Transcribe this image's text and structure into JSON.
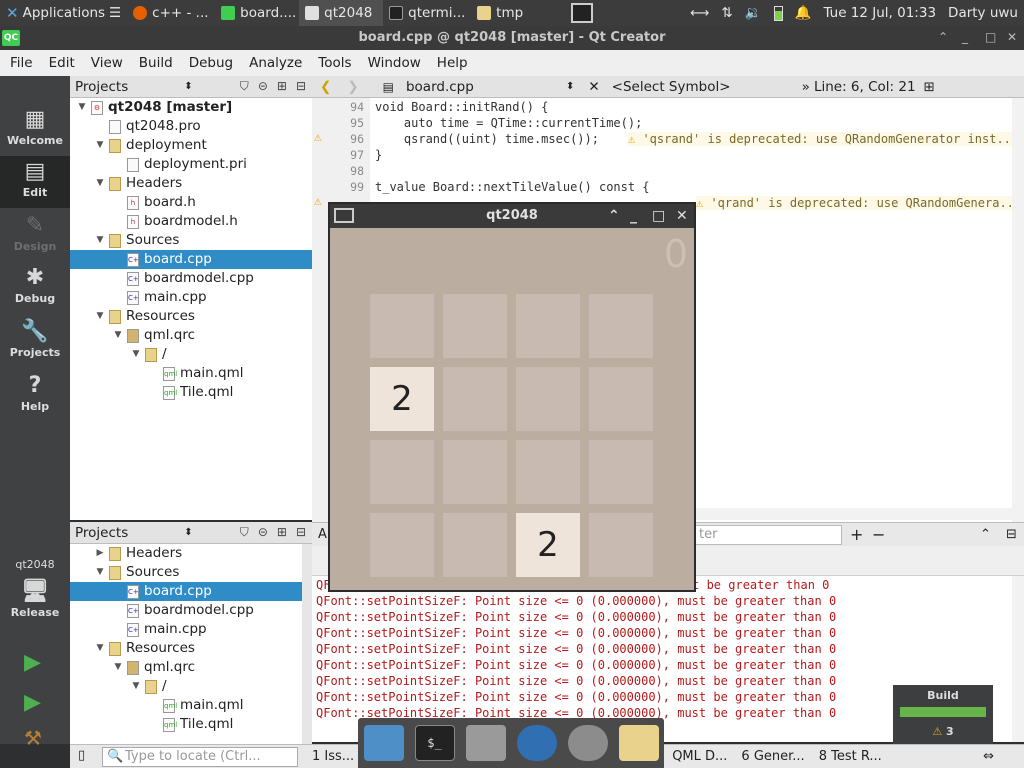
{
  "taskbar": {
    "applications": "Applications",
    "buttons": [
      {
        "label": "c++ - ...",
        "color": "#e66000"
      },
      {
        "label": "board....",
        "color": "#41cd52"
      },
      {
        "label": "qt2048",
        "color": "#e0e0e0"
      },
      {
        "label": "qtermi...",
        "color": "#999999"
      },
      {
        "label": "tmp",
        "color": "#e9d28c"
      }
    ],
    "clock": "Tue 12 Jul, 01:33",
    "user": "Darty uwu"
  },
  "window": {
    "title": "board.cpp @ qt2048 [master] - Qt Creator",
    "logo": "QC"
  },
  "menu": [
    "File",
    "Edit",
    "View",
    "Build",
    "Debug",
    "Analyze",
    "Tools",
    "Window",
    "Help"
  ],
  "modes": {
    "welcome": "Welcome",
    "edit": "Edit",
    "design": "Design",
    "debug": "Debug",
    "projects": "Projects",
    "help": "Help",
    "target_name": "qt2048",
    "target_mode": "Release"
  },
  "projects_top": {
    "title": "Projects",
    "nodes": [
      {
        "label": "qt2048 [master]",
        "bold": true,
        "type": "project"
      },
      {
        "label": "qt2048.pro",
        "type": "file"
      },
      {
        "label": "deployment",
        "type": "folder"
      },
      {
        "label": "deployment.pri",
        "type": "file"
      },
      {
        "label": "Headers",
        "type": "folder"
      },
      {
        "label": "board.h",
        "type": "header"
      },
      {
        "label": "boardmodel.h",
        "type": "header"
      },
      {
        "label": "Sources",
        "type": "folder"
      },
      {
        "label": "board.cpp",
        "type": "cpp",
        "selected": true
      },
      {
        "label": "boardmodel.cpp",
        "type": "cpp"
      },
      {
        "label": "main.cpp",
        "type": "cpp"
      },
      {
        "label": "Resources",
        "type": "folder"
      },
      {
        "label": "qml.qrc",
        "type": "res"
      },
      {
        "label": "/",
        "type": "folder"
      },
      {
        "label": "main.qml",
        "type": "qml"
      },
      {
        "label": "Tile.qml",
        "type": "qml"
      }
    ]
  },
  "projects_bottom": {
    "title": "Projects",
    "nodes": [
      {
        "label": "Headers",
        "type": "folder"
      },
      {
        "label": "Sources",
        "type": "folder"
      },
      {
        "label": "board.cpp",
        "type": "cpp",
        "selected": true
      },
      {
        "label": "boardmodel.cpp",
        "type": "cpp"
      },
      {
        "label": "main.cpp",
        "type": "cpp"
      },
      {
        "label": "Resources",
        "type": "folder"
      },
      {
        "label": "qml.qrc",
        "type": "res"
      },
      {
        "label": "/",
        "type": "folder"
      },
      {
        "label": "main.qml",
        "type": "qml"
      },
      {
        "label": "Tile.qml",
        "type": "qml"
      }
    ]
  },
  "editor": {
    "file": "board.cpp",
    "symbol": "<Select Symbol>",
    "position": "Line: 6, Col: 21",
    "lines": [
      {
        "n": "94",
        "text": "void Board::initRand() {"
      },
      {
        "n": "95",
        "text": "    auto time = QTime::currentTime();"
      },
      {
        "n": "96",
        "text": "    qsrand((uint) time.msec());",
        "warn": "'qsrand' is deprecated: use QRandomGenerator inst..."
      },
      {
        "n": "97",
        "text": "}"
      },
      {
        "n": "98",
        "text": ""
      },
      {
        "n": "99",
        "text": "t_value Board::nextTileValue() const {"
      },
      {
        "n": "",
        "text": "",
        "warn": "'qrand' is deprecated: use QRandomGenera..."
      }
    ]
  },
  "output": {
    "filter_placeholder": "ter",
    "tab": "A",
    "line_prefix": "QFont::setPointSizeF: Point size <= 0 (0.000000), must be greater than 0",
    "first_line": "must be greater than 0",
    "lines": [
      "QFont::setPointSizeF: Point size <= 0 (0.000000), must be greater than 0",
      "QFont::setPointSizeF: Point size <= 0 (0.000000), must be greater than 0",
      "QFont::setPointSizeF: Point size <= 0 (0.000000), must be greater than 0",
      "QFont::setPointSizeF: Point size <= 0 (0.000000), must be greater than 0",
      "QFont::setPointSizeF: Point size <= 0 (0.000000), must be greater than 0",
      "QFont::setPointSizeF: Point size <= 0 (0.000000), must be greater than 0",
      "QFont::setPointSizeF: Point size <= 0 (0.000000), must be greater than 0",
      "QFont::setPointSizeF: Point size <= 0 (0.000000), must be greater than 0",
      "QFont::setPointSizeF: Point size <= 0 (0.000000), must be greater than 0"
    ]
  },
  "status": {
    "locator_placeholder": "Type to locate (Ctrl...",
    "tab1": "1 Iss...",
    "tab_qml": "QML D...",
    "tab6": "6 Gener...",
    "tab8": "8 Test R..."
  },
  "build": {
    "label": "Build",
    "warnings": "3"
  },
  "game": {
    "title": "qt2048",
    "score": "0",
    "board": [
      [
        "",
        "",
        "",
        ""
      ],
      [
        "2",
        "",
        "",
        ""
      ],
      [
        "",
        "",
        "",
        ""
      ],
      [
        "",
        "",
        "2",
        ""
      ]
    ]
  }
}
